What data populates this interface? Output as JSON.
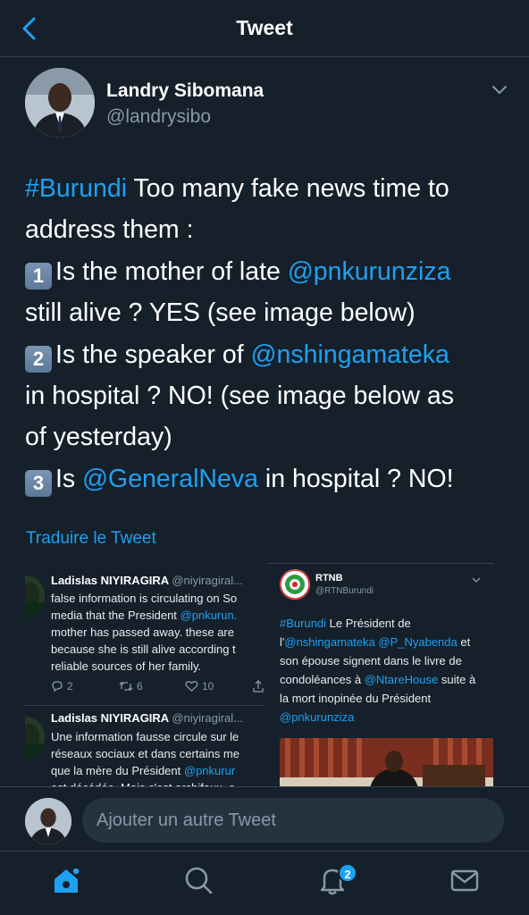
{
  "header": {
    "title": "Tweet"
  },
  "author": {
    "name": "Landry Sibomana",
    "handle": "@landrysibo"
  },
  "tweet": {
    "lines": [
      [
        {
          "t": "#Burundi",
          "link": true
        },
        {
          "t": " Too many fake news time to"
        }
      ],
      [
        {
          "t": "address them :"
        }
      ],
      [
        {
          "k": "1"
        },
        {
          "t": "Is the mother of late "
        },
        {
          "t": "@pnkurunziza",
          "link": true
        }
      ],
      [
        {
          "t": "still alive ? YES (see image below)"
        }
      ],
      [
        {
          "k": "2"
        },
        {
          "t": "Is the speaker of "
        },
        {
          "t": "@nshingamateka",
          "link": true
        }
      ],
      [
        {
          "t": "in hospital ? NO! (see image below as"
        }
      ],
      [
        {
          "t": "of yesterday)"
        }
      ],
      [
        {
          "k": "3"
        },
        {
          "t": "Is "
        },
        {
          "t": "@GeneralNeva",
          "link": true
        },
        {
          "t": " in hospital ? NO!"
        }
      ]
    ]
  },
  "translate_label": "Traduire le Tweet",
  "embedded": {
    "tweet1": {
      "name": "Ladislas NIYIRAGIRA",
      "handle": "@niyiragiral...",
      "lines": [
        [
          {
            "t": "false information is circulating on So"
          }
        ],
        [
          {
            "t": "media that the President "
          },
          {
            "t": "@pnkurun.",
            "link": true
          }
        ],
        [
          {
            "t": "mother has passed away. these are"
          }
        ],
        [
          {
            "t": "because she is still alive according t"
          }
        ],
        [
          {
            "t": "reliable sources of her family."
          }
        ]
      ],
      "replies": "2",
      "retweets": "6",
      "likes": "10"
    },
    "tweet2": {
      "name": "Ladislas NIYIRAGIRA",
      "handle": "@niyiragiral...",
      "lines": [
        [
          {
            "t": "Une information fausse circule sur le"
          }
        ],
        [
          {
            "t": "réseaux sociaux et dans certains me"
          }
        ],
        [
          {
            "t": "que la  mère du Président "
          },
          {
            "t": "@pnkurur",
            "link": true
          }
        ],
        [
          {
            "t": "est décédée. Mais c'est archifaux, c"
          }
        ]
      ]
    },
    "rtnb": {
      "name": "RTNB",
      "handle": "@RTNBurundi",
      "lines": [
        [
          {
            "t": "#Burundi",
            "link": true
          },
          {
            "t": " Le Président de"
          }
        ],
        [
          {
            "t": "l'"
          },
          {
            "t": "@nshingamateka",
            "link": true
          },
          {
            "t": " "
          },
          {
            "t": "@P_Nyabenda",
            "link": true
          },
          {
            "t": " et"
          }
        ],
        [
          {
            "t": "son épouse  signent dans le livre de"
          }
        ],
        [
          {
            "t": "condoléances à "
          },
          {
            "t": "@NtareHouse",
            "link": true
          },
          {
            "t": " suite à"
          }
        ],
        [
          {
            "t": "la mort inopinée du Président"
          }
        ],
        [
          {
            "t": "@pnkurunziza",
            "link": true
          }
        ]
      ]
    }
  },
  "compose": {
    "placeholder": "Ajouter un autre Tweet"
  },
  "tabs": {
    "notifications_badge": "2"
  },
  "colors": {
    "background": "#15202b",
    "accent": "#1da1f2",
    "secondary_text": "#8899a6",
    "divider": "#38444d"
  }
}
